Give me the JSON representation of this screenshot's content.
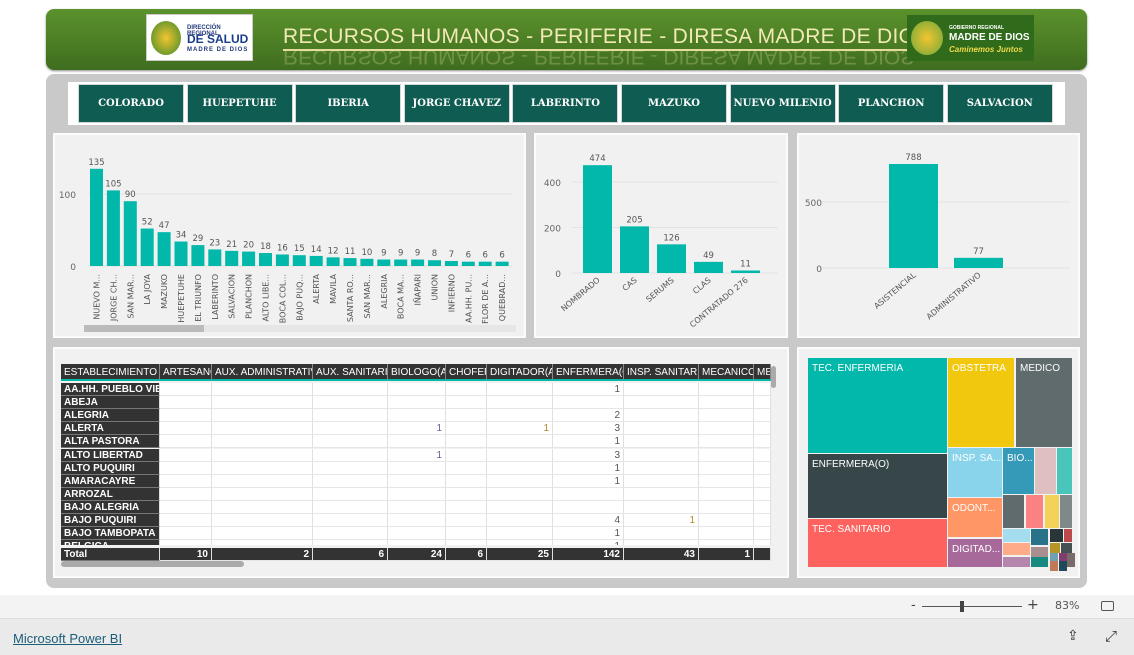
{
  "header": {
    "title": "RECURSOS HUMANOS - PERIFERIE - DIRESA MADRE DE DIOS",
    "logo_left": {
      "line1": "DIRECCIÓN REGIONAL",
      "line2": "DE SALUD",
      "line3": "MADRE DE DIOS"
    },
    "logo_right": {
      "line1": "GOBIERNO REGIONAL",
      "line2": "MADRE DE DIOS",
      "line3": "Caminemos Juntos"
    }
  },
  "nav": [
    "COLORADO",
    "HUEPETUHE",
    "IBERIA",
    "JORGE CHAVEZ",
    "LABERINTO",
    "MAZUKO",
    "NUEVO MILENIO",
    "PLANCHON",
    "SALVACION"
  ],
  "accent": "#01b8aa",
  "chart_data": [
    {
      "type": "bar",
      "title": "",
      "ylim": [
        0,
        140
      ],
      "yticks": [
        0,
        100
      ],
      "categories": [
        "NUEVO M...",
        "JORGE CH...",
        "SAN MAR...",
        "LA JOYA",
        "MAZUKO",
        "HUEPETUHE",
        "EL TRIUNFO",
        "LABERINTO",
        "SALVACION",
        "PLANCHON",
        "ALTO LIBE...",
        "BOCA COL...",
        "BAJO PUQ...",
        "ALERTA",
        "MAVILA",
        "SANTA RO...",
        "SAN MAR...",
        "ALEGRIA",
        "BOCA MA...",
        "IÑAPARI",
        "UNION",
        "INFIERNO",
        "AA.HH. PU...",
        "FLOR DE A...",
        "QUEBRAD..."
      ],
      "values": [
        135,
        105,
        90,
        52,
        47,
        34,
        29,
        23,
        21,
        20,
        18,
        16,
        15,
        14,
        12,
        11,
        10,
        9,
        9,
        9,
        8,
        7,
        6,
        6,
        6
      ]
    },
    {
      "type": "bar",
      "title": "",
      "ylim": [
        0,
        500
      ],
      "yticks": [
        0,
        200,
        400
      ],
      "categories": [
        "NOMBRADO",
        "CAS",
        "SERUMS",
        "CLAS",
        "CONTRATADO 276"
      ],
      "values": [
        474,
        205,
        126,
        49,
        11
      ]
    },
    {
      "type": "bar",
      "title": "",
      "ylim": [
        0,
        850
      ],
      "yticks": [
        0,
        500
      ],
      "categories": [
        "ASISTENCIAL",
        "ADMINISTRATIVO"
      ],
      "values": [
        788,
        77
      ]
    }
  ],
  "table": {
    "row_header": "ESTABLECIMIENTO",
    "columns": [
      "ARTESANO",
      "AUX. ADMINISTRATIVO",
      "AUX. SANITARIO",
      "BIOLOGO(A)",
      "CHOFER",
      "DIGITADOR(A)",
      "ENFERMERA(O)",
      "INSP. SANITARIO",
      "MECANICO",
      "ME"
    ],
    "rows": [
      {
        "name": "AA.HH. PUEBLO VIEJO",
        "values": [
          "",
          "",
          "",
          "",
          "",
          "",
          "1",
          "",
          "",
          ""
        ]
      },
      {
        "name": "ABEJA",
        "values": [
          "",
          "",
          "",
          "",
          "",
          "",
          "",
          "",
          "",
          ""
        ]
      },
      {
        "name": "ALEGRIA",
        "values": [
          "",
          "",
          "",
          "",
          "",
          "",
          "2",
          "",
          "",
          ""
        ]
      },
      {
        "name": "ALERTA",
        "values": [
          "",
          "",
          "",
          "1",
          "",
          "1",
          "3",
          "",
          "",
          ""
        ]
      },
      {
        "name": "ALTA PASTORA",
        "values": [
          "",
          "",
          "",
          "",
          "",
          "",
          "1",
          "",
          "",
          ""
        ]
      },
      {
        "name": "ALTO LIBERTAD",
        "values": [
          "",
          "",
          "",
          "1",
          "",
          "",
          "3",
          "",
          "",
          ""
        ]
      },
      {
        "name": "ALTO PUQUIRI",
        "values": [
          "",
          "",
          "",
          "",
          "",
          "",
          "1",
          "",
          "",
          ""
        ]
      },
      {
        "name": "AMARACAYRE",
        "values": [
          "",
          "",
          "",
          "",
          "",
          "",
          "1",
          "",
          "",
          ""
        ]
      },
      {
        "name": "ARROZAL",
        "values": [
          "",
          "",
          "",
          "",
          "",
          "",
          "",
          "",
          "",
          ""
        ]
      },
      {
        "name": "BAJO ALEGRIA",
        "values": [
          "",
          "",
          "",
          "",
          "",
          "",
          "",
          "",
          "",
          ""
        ]
      },
      {
        "name": "BAJO PUQUIRI",
        "values": [
          "",
          "",
          "",
          "",
          "",
          "",
          "4",
          "1",
          "",
          ""
        ]
      },
      {
        "name": "BAJO TAMBOPATA",
        "values": [
          "",
          "",
          "",
          "",
          "",
          "",
          "1",
          "",
          "",
          ""
        ]
      },
      {
        "name": "BELGICA",
        "values": [
          "",
          "",
          "",
          "",
          "",
          "",
          "1",
          "",
          "",
          ""
        ]
      }
    ],
    "total_label": "Total",
    "totals": [
      "10",
      "2",
      "6",
      "24",
      "6",
      "25",
      "142",
      "43",
      "1",
      ""
    ]
  },
  "treemap": [
    {
      "label": "TEC. ENFERMERIA",
      "color": "#01b8aa"
    },
    {
      "label": "OBSTETRA",
      "color": "#f2c80f"
    },
    {
      "label": "MEDICO",
      "color": "#5f6b6d"
    },
    {
      "label": "ENFERMERA(O)",
      "color": "#374649"
    },
    {
      "label": "TEC. SANITARIO",
      "color": "#fd625e"
    },
    {
      "label": "INSP. SA...",
      "color": "#8ad4eb"
    },
    {
      "label": "BIO...",
      "color": "#3599b8"
    },
    {
      "label": "",
      "color": "#dfbfbf"
    },
    {
      "label": "",
      "color": "#4ac5bb"
    },
    {
      "label": "ODONT...",
      "color": "#fe9666"
    },
    {
      "label": "DIGITAD...",
      "color": "#a66999"
    },
    {
      "label": "",
      "color": "#5f6b6d"
    },
    {
      "label": "",
      "color": "#fb8281"
    },
    {
      "label": "",
      "color": "#f4d25a"
    },
    {
      "label": "",
      "color": "#7f898a"
    },
    {
      "label": "",
      "color": "#a4ddee"
    },
    {
      "label": "",
      "color": "#fdab89"
    },
    {
      "label": "",
      "color": "#b687ac"
    },
    {
      "label": "",
      "color": "#28738a"
    },
    {
      "label": "",
      "color": "#a78f8f"
    },
    {
      "label": "",
      "color": "#168980"
    },
    {
      "label": "",
      "color": "#293537"
    },
    {
      "label": "",
      "color": "#bb4a4a"
    },
    {
      "label": "",
      "color": "#b59525"
    },
    {
      "label": "",
      "color": "#475052"
    },
    {
      "label": "",
      "color": "#6ca2b4"
    },
    {
      "label": "",
      "color": "#803e6f"
    },
    {
      "label": "",
      "color": "#c07a5a"
    },
    {
      "label": "",
      "color": "#1e4a5a"
    },
    {
      "label": "",
      "color": "#7a6a6a"
    }
  ],
  "zoom": {
    "minus": "-",
    "plus": "+",
    "level": "83%"
  },
  "footer": {
    "brand": "Microsoft Power BI"
  }
}
